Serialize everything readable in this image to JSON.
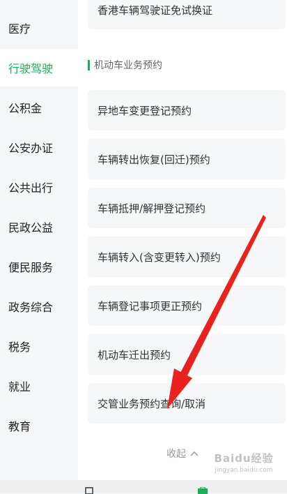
{
  "sidebar": {
    "items": [
      {
        "label": "医疗"
      },
      {
        "label": "行驶驾驶"
      },
      {
        "label": "公积金"
      },
      {
        "label": "公安办证"
      },
      {
        "label": "公共出行"
      },
      {
        "label": "民政公益"
      },
      {
        "label": "便民服务"
      },
      {
        "label": "政务综合"
      },
      {
        "label": "税务"
      },
      {
        "label": "就业"
      },
      {
        "label": "教育"
      }
    ],
    "active_index": 1
  },
  "content": {
    "top_card": "香港车辆驾驶证免试换证",
    "section_title": "机动车业务预约",
    "cards": [
      {
        "label": "异地车变更登记预约"
      },
      {
        "label": "车辆转出恢复(回迁)预约"
      },
      {
        "label": "车辆抵押/解押登记预约"
      },
      {
        "label": "车辆转入(含变更转入)预约"
      },
      {
        "label": "车辆登记事项更正预约"
      },
      {
        "label": "机动车迁出预约"
      },
      {
        "label": "交管业务预约查询/取消"
      }
    ],
    "collapse_label": "收起"
  },
  "watermark": {
    "main": "Baidu经验",
    "sub": "jingyan.baidu.com"
  },
  "colors": {
    "accent": "#1aad5a",
    "arrow": "#e8231f"
  }
}
